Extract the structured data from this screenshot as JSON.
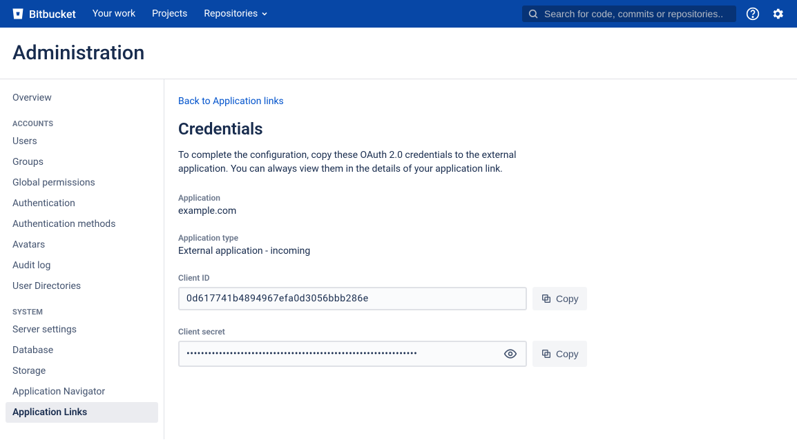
{
  "topnav": {
    "product": "Bitbucket",
    "links": [
      "Your work",
      "Projects",
      "Repositories"
    ],
    "search_placeholder": "Search for code, commits or repositories.."
  },
  "page": {
    "title": "Administration"
  },
  "sidebar": {
    "top": [
      "Overview"
    ],
    "sections": [
      {
        "label": "ACCOUNTS",
        "items": [
          "Users",
          "Groups",
          "Global permissions",
          "Authentication",
          "Authentication methods",
          "Avatars",
          "Audit log",
          "User Directories"
        ]
      },
      {
        "label": "SYSTEM",
        "items": [
          "Server settings",
          "Database",
          "Storage",
          "Application Navigator",
          "Application Links"
        ]
      }
    ],
    "active": "Application Links"
  },
  "main": {
    "back_link": "Back to Application links",
    "heading": "Credentials",
    "description": "To complete the configuration, copy these OAuth 2.0 credentials to the external application. You can always view them in the details of your application link.",
    "application_label": "Application",
    "application_value": "example.com",
    "application_type_label": "Application type",
    "application_type_value": "External application - incoming",
    "client_id_label": "Client ID",
    "client_id_value": "0d617741b4894967efa0d3056bbb286e",
    "client_secret_label": "Client secret",
    "client_secret_value": "••••••••••••••••••••••••••••••••••••••••••••••••••••••••••••••••",
    "copy_label": "Copy"
  }
}
